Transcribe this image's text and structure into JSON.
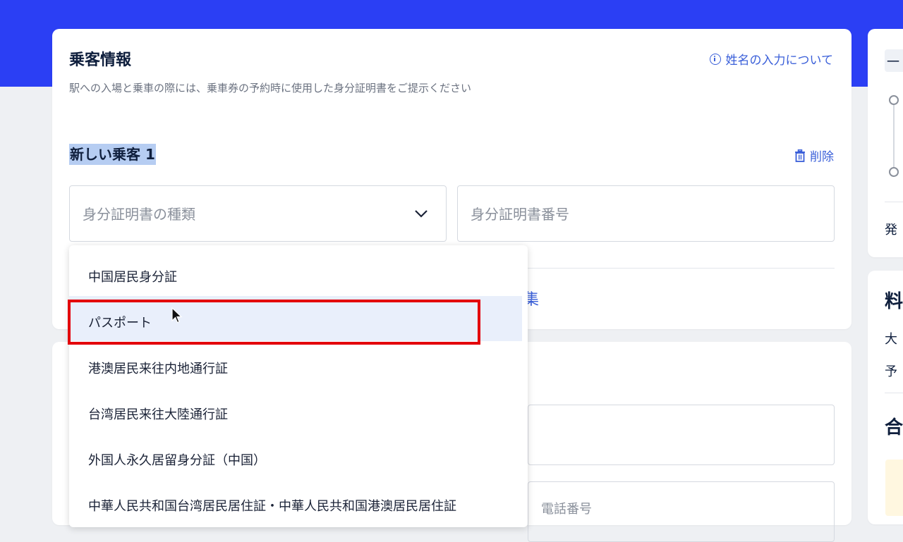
{
  "passenger_info": {
    "title": "乗客情報",
    "subtitle": "駅への入場と乗車の際には、乗車券の予約時に使用した身分証明書をご提示ください",
    "name_help_link": "姓名の入力について",
    "passenger_label": "新しい乗客 1",
    "delete_label": "削除",
    "id_type_placeholder": "身分証明書の種類",
    "id_number_placeholder": "身分証明書番号",
    "edit_link_fragment": "集"
  },
  "id_type_options": [
    "中国居民身分証",
    "パスポート",
    "港澳居民来往内地通行証",
    "台湾居民来往大陸通行証",
    "外国人永久居留身分証（中国）",
    "中華人民共和国台湾居民居住証・中華人民共和国港澳居民居住証"
  ],
  "highlighted_option": "パスポート",
  "contact": {
    "phone_placeholder_fragment": "電話番号"
  },
  "side_panel": {
    "tab_fragment": "一",
    "issue_fragment": "発",
    "fare_fragment": "料",
    "adult_fragment": "大",
    "reserve_fragment": "予",
    "total_fragment": "合"
  },
  "colors": {
    "brand_blue": "#2b3ff4",
    "link_blue": "#3a5fd9",
    "annotation_red": "#e3000b",
    "option_highlight": "#e9effb"
  }
}
